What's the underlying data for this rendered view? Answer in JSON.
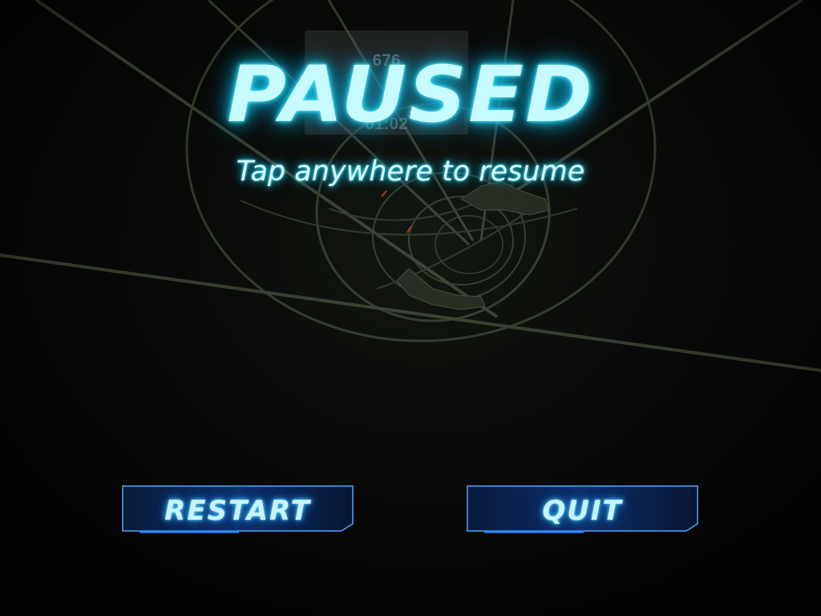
{
  "hud": {
    "score": "676",
    "time": "01:02"
  },
  "pause_overlay": {
    "title": "PAUSED",
    "hint": "Tap anywhere to resume"
  },
  "buttons": {
    "restart_label": "RESTART",
    "quit_label": "QUIT"
  },
  "colors": {
    "glow_cyan": "#1fd2ee",
    "button_border": "#4aa6ff",
    "tunnel_line": "#3a4232"
  }
}
